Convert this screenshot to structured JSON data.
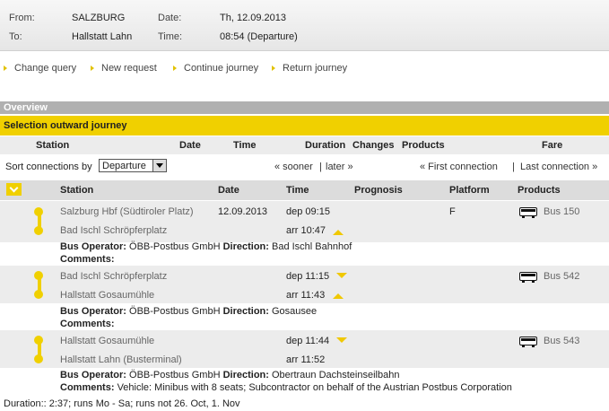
{
  "journey": {
    "from_label": "From:",
    "from_value": "SALZBURG",
    "to_label": "To:",
    "to_value": "Hallstatt Lahn",
    "date_label": "Date:",
    "date_value": "Th, 12.09.2013",
    "time_label": "Time:",
    "time_value": "08:54 (Departure)"
  },
  "nav": {
    "change_query": "Change query",
    "new_request": "New request",
    "continue_journey": "Continue journey",
    "return_journey": "Return journey"
  },
  "overview_title": "Overview",
  "selection_title": "Selection outward journey",
  "summary_columns": {
    "station": "Station",
    "date": "Date",
    "time": "Time",
    "duration": "Duration",
    "changes": "Changes",
    "products": "Products",
    "fare": "Fare"
  },
  "sort": {
    "label": "Sort connections by",
    "selected": "Departure",
    "sooner": "« sooner",
    "separator": "|",
    "later": "later »",
    "first_connection": "« First connection",
    "last_connection": "Last connection »"
  },
  "detail_columns": {
    "station": "Station",
    "date": "Date",
    "time": "Time",
    "prognosis": "Prognosis",
    "platform": "Platform",
    "products": "Products"
  },
  "legs": [
    {
      "dep_station": "Salzburg Hbf (Südtiroler Platz)",
      "dep_date": "12.09.2013",
      "dep_time": "dep 09:15",
      "dep_platform": "F",
      "arr_station": "Bad Ischl Schröpferplatz",
      "arr_time": "arr 10:47",
      "product": "Bus 150",
      "operator_label": "Bus Operator:",
      "operator_value": "ÖBB-Postbus GmbH",
      "direction_label": "Direction:",
      "direction_value": "Bad Ischl Bahnhof",
      "comments_label": "Comments:",
      "comments_value": ""
    },
    {
      "dep_station": "Bad Ischl Schröpferplatz",
      "dep_time": "dep 11:15",
      "arr_station": "Hallstatt Gosaumühle",
      "arr_time": "arr 11:43",
      "product": "Bus 542",
      "operator_label": "Bus Operator:",
      "operator_value": "ÖBB-Postbus GmbH",
      "direction_label": "Direction:",
      "direction_value": "Gosausee",
      "comments_label": "Comments:",
      "comments_value": ""
    },
    {
      "dep_station": "Hallstatt Gosaumühle",
      "dep_time": "dep 11:44",
      "arr_station": "Hallstatt Lahn (Busterminal)",
      "arr_time": "arr 11:52",
      "product": "Bus 543",
      "operator_label": "Bus Operator:",
      "operator_value": "ÖBB-Postbus GmbH",
      "direction_label": "Direction:",
      "direction_value": "Obertraun Dachsteinseilbahn",
      "comments_label": "Comments:",
      "comments_value": "Vehicle: Minibus with 8 seats; Subcontractor on behalf of the Austrian Postbus Corporation"
    }
  ],
  "footer": "Duration:: 2:37; runs Mo - Sa; runs not 26. Oct, 1. Nov",
  "icons": {
    "nav_arrow": "triangle-right-icon",
    "collapse": "chevron-down-icon",
    "bus": "bus-icon",
    "prognosis_down": "triangle-down-icon",
    "prognosis_up": "triangle-up-icon"
  },
  "colors": {
    "accent": "#f0d000",
    "header_bar": "#b0b0b0",
    "row_gray": "#ececec"
  }
}
